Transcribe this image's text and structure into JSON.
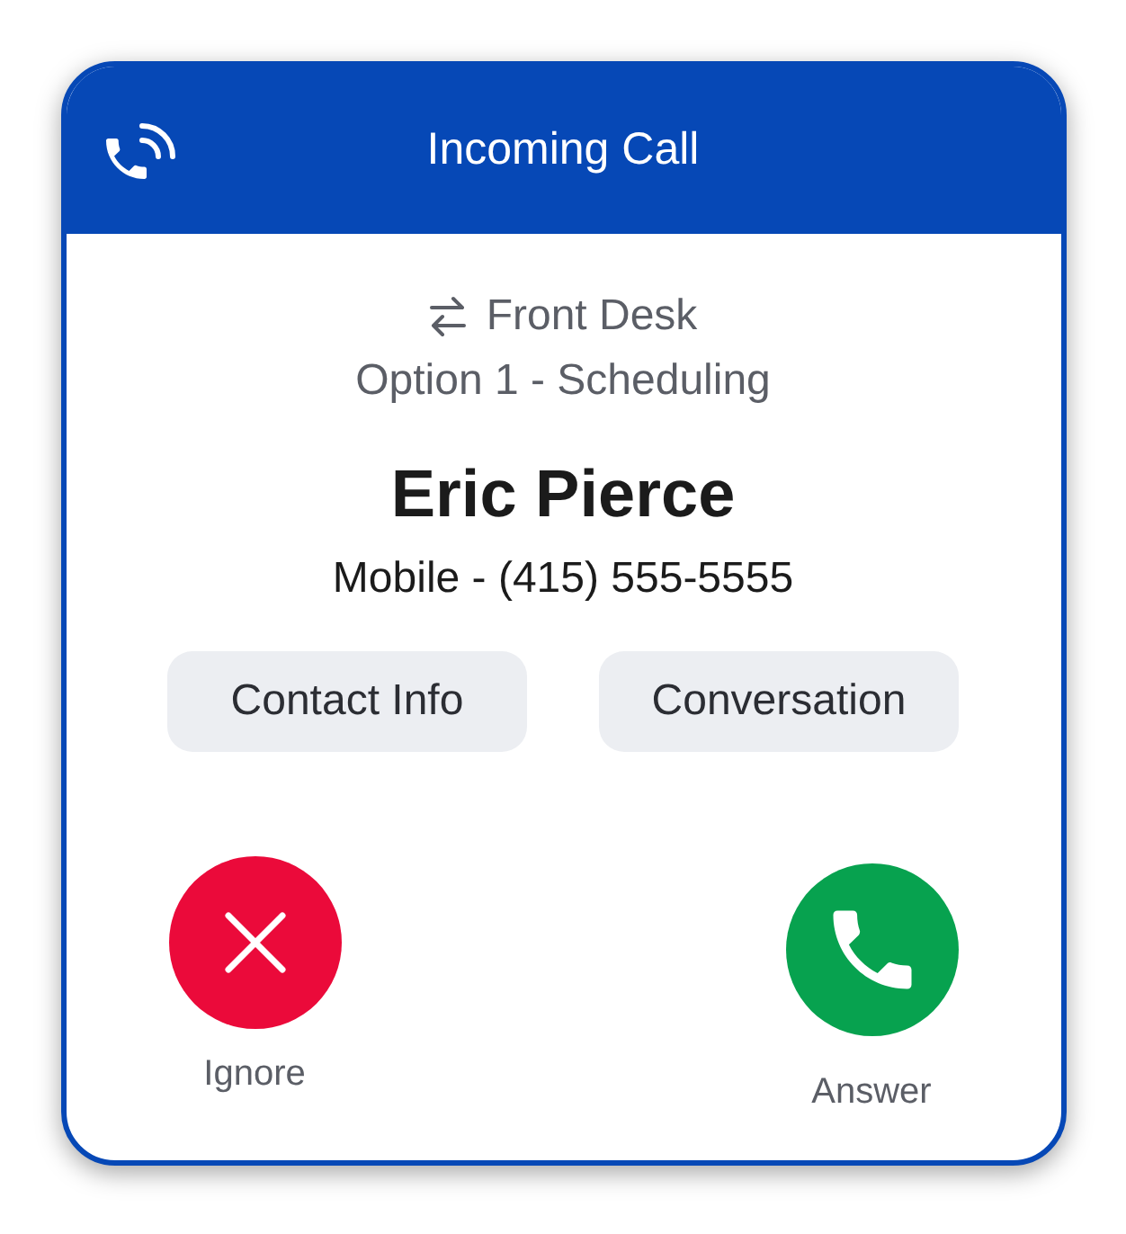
{
  "header": {
    "title": "Incoming Call"
  },
  "route": {
    "queue": "Front Desk",
    "option": "Option 1 - Scheduling"
  },
  "caller": {
    "name": "Eric Pierce",
    "number": "Mobile - (415) 555-5555"
  },
  "links": [
    "Contact Info",
    "Conversation"
  ],
  "actions": [
    {
      "kind": "decline",
      "label": "Ignore"
    },
    {
      "kind": "accept",
      "label": "Answer"
    }
  ]
}
